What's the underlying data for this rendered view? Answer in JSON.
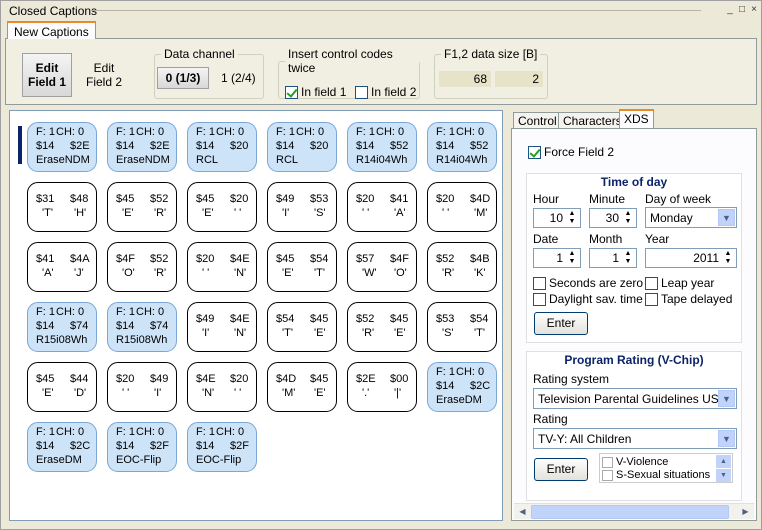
{
  "window": {
    "title": "Closed Captions",
    "min": "_",
    "max": "□",
    "close": "×"
  },
  "tab": "New Captions",
  "top": {
    "edit_field1": "Edit Field 1",
    "edit_field2": "Edit Field 2",
    "data_channel": {
      "legend": "Data channel",
      "selected": "0 (1/3)",
      "other": "1 (2/4)"
    },
    "insert_twice": {
      "legend": "Insert control codes twice",
      "field1": "In field 1",
      "field1_checked": true,
      "field2": "In field 2",
      "field2_checked": false
    },
    "data_size": {
      "legend": "F1,2 data size [B]",
      "v1": "68",
      "v2": "2"
    }
  },
  "cells": [
    {
      "hl": true,
      "h": [
        "F: 1",
        "CH: 0"
      ],
      "a": "$14",
      "b": "$2E",
      "l": "EraseNDM"
    },
    {
      "hl": true,
      "h": [
        "F: 1",
        "CH: 0"
      ],
      "a": "$14",
      "b": "$2E",
      "l": "EraseNDM"
    },
    {
      "hl": true,
      "h": [
        "F: 1",
        "CH: 0"
      ],
      "a": "$14",
      "b": "$20",
      "l": "RCL"
    },
    {
      "hl": true,
      "h": [
        "F: 1",
        "CH: 0"
      ],
      "a": "$14",
      "b": "$20",
      "l": "RCL"
    },
    {
      "hl": true,
      "h": [
        "F: 1",
        "CH: 0"
      ],
      "a": "$14",
      "b": "$52",
      "l": "R14i04Wh"
    },
    {
      "hl": true,
      "h": [
        "F: 1",
        "CH: 0"
      ],
      "a": "$14",
      "b": "$52",
      "l": "R14i04Wh"
    },
    {
      "hl": false,
      "a": "$31",
      "b": "$48",
      "ca": "'T'",
      "cb": "'H'"
    },
    {
      "hl": false,
      "a": "$45",
      "b": "$52",
      "ca": "'E'",
      "cb": "'R'"
    },
    {
      "hl": false,
      "a": "$45",
      "b": "$20",
      "ca": "'E'",
      "cb": "' '"
    },
    {
      "hl": false,
      "a": "$49",
      "b": "$53",
      "ca": "'I'",
      "cb": "'S'"
    },
    {
      "hl": false,
      "a": "$20",
      "b": "$41",
      "ca": "' '",
      "cb": "'A'"
    },
    {
      "hl": false,
      "a": "$20",
      "b": "$4D",
      "ca": "' '",
      "cb": "'M'"
    },
    {
      "hl": false,
      "a": "$41",
      "b": "$4A",
      "ca": "'A'",
      "cb": "'J'"
    },
    {
      "hl": false,
      "a": "$4F",
      "b": "$52",
      "ca": "'O'",
      "cb": "'R'"
    },
    {
      "hl": false,
      "a": "$20",
      "b": "$4E",
      "ca": "' '",
      "cb": "'N'"
    },
    {
      "hl": false,
      "a": "$45",
      "b": "$54",
      "ca": "'E'",
      "cb": "'T'"
    },
    {
      "hl": false,
      "a": "$57",
      "b": "$4F",
      "ca": "'W'",
      "cb": "'O'"
    },
    {
      "hl": false,
      "a": "$52",
      "b": "$4B",
      "ca": "'R'",
      "cb": "'K'"
    },
    {
      "hl": true,
      "h": [
        "F: 1",
        "CH: 0"
      ],
      "a": "$14",
      "b": "$74",
      "l": "R15i08Wh"
    },
    {
      "hl": true,
      "h": [
        "F: 1",
        "CH: 0"
      ],
      "a": "$14",
      "b": "$74",
      "l": "R15i08Wh"
    },
    {
      "hl": false,
      "a": "$49",
      "b": "$4E",
      "ca": "'I'",
      "cb": "'N'"
    },
    {
      "hl": false,
      "a": "$54",
      "b": "$45",
      "ca": "'T'",
      "cb": "'E'"
    },
    {
      "hl": false,
      "a": "$52",
      "b": "$45",
      "ca": "'R'",
      "cb": "'E'"
    },
    {
      "hl": false,
      "a": "$53",
      "b": "$54",
      "ca": "'S'",
      "cb": "'T'"
    },
    {
      "hl": false,
      "a": "$45",
      "b": "$44",
      "ca": "'E'",
      "cb": "'D'"
    },
    {
      "hl": false,
      "a": "$20",
      "b": "$49",
      "ca": "' '",
      "cb": "'I'"
    },
    {
      "hl": false,
      "a": "$4E",
      "b": "$20",
      "ca": "'N'",
      "cb": "' '"
    },
    {
      "hl": false,
      "a": "$4D",
      "b": "$45",
      "ca": "'M'",
      "cb": "'E'"
    },
    {
      "hl": false,
      "a": "$2E",
      "b": "$00",
      "ca": "'.'",
      "cb": "'|'"
    },
    {
      "hl": true,
      "h": [
        "F: 1",
        "CH: 0"
      ],
      "a": "$14",
      "b": "$2C",
      "l": "EraseDM"
    },
    {
      "hl": true,
      "h": [
        "F: 1",
        "CH: 0"
      ],
      "a": "$14",
      "b": "$2C",
      "l": "EraseDM"
    },
    {
      "hl": true,
      "h": [
        "F: 1",
        "CH: 0"
      ],
      "a": "$14",
      "b": "$2F",
      "l": "EOC-Flip"
    },
    {
      "hl": true,
      "h": [
        "F: 1",
        "CH: 0"
      ],
      "a": "$14",
      "b": "$2F",
      "l": "EOC-Flip"
    }
  ],
  "rtabs": [
    "Control",
    "Characters",
    "XDS"
  ],
  "xds": {
    "force_field2": "Force Field 2",
    "force_field2_checked": true,
    "tod": {
      "title": "Time of day",
      "hour_l": "Hour",
      "hour": "10",
      "minute_l": "Minute",
      "minute": "30",
      "dow_l": "Day of week",
      "dow": "Monday",
      "date_l": "Date",
      "date": "1",
      "month_l": "Month",
      "month": "1",
      "year_l": "Year",
      "year": "2011",
      "sec_zero": "Seconds are zero",
      "leap": "Leap year",
      "dst": "Daylight sav. time",
      "tape": "Tape delayed",
      "enter": "Enter"
    },
    "pr": {
      "title": "Program Rating (V-Chip)",
      "sys_l": "Rating system",
      "sys": "Television Parental Guidelines US TV",
      "rating_l": "Rating",
      "rating": "TV-Y: All Children",
      "enter": "Enter",
      "items": [
        "V-Violence",
        "S-Sexual situations"
      ]
    }
  }
}
